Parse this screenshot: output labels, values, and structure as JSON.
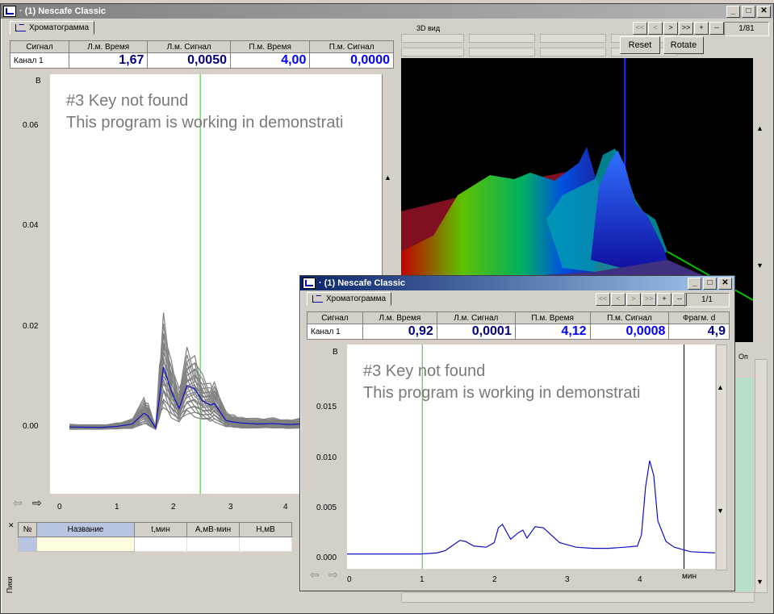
{
  "back_window": {
    "title": "· (1) Nescafe Classic",
    "tab": "Хроматограмма",
    "headers": [
      "Сигнал",
      "Л.м. Время",
      "Л.м. Сигнал",
      "П.м. Время",
      "П.м. Сигнал"
    ],
    "row": {
      "channel": "Канал 1",
      "l_time": "1,67",
      "l_signal": "0,0050",
      "r_time": "4,00",
      "r_signal": "0,0000"
    },
    "demo_line1": "#3 Key not found",
    "demo_line2": "This program is working in demonstrati",
    "y_unit": "В",
    "y_ticks": [
      "0.06",
      "0.04",
      "0.02",
      "0.00"
    ],
    "x_ticks": [
      "0",
      "1",
      "2",
      "3",
      "4"
    ],
    "view3d_label": "3D вид",
    "nav_buttons": [
      "<<",
      "<",
      ">",
      ">>",
      "+",
      "--"
    ],
    "counter": "1/81",
    "reset_label": "Reset",
    "rotate_label": "Rotate",
    "peaks_headers": [
      "№",
      "Название",
      "t,мин",
      "A,мВ·мин",
      "H,мВ"
    ],
    "peaks_side_label": "Пики",
    "right_col_label": "Оп"
  },
  "front_window": {
    "title": "· (1) Nescafe Classic",
    "tab": "Хроматограмма",
    "nav_buttons": [
      "<<",
      "<",
      ">",
      ">>",
      "+",
      "--"
    ],
    "counter": "1/1",
    "headers": [
      "Сигнал",
      "Л.м. Время",
      "Л.м. Сигнал",
      "П.м. Время",
      "П.м. Сигнал",
      "Фрагм. d"
    ],
    "row": {
      "channel": "Канал 1",
      "l_time": "0,92",
      "l_signal": "0,0001",
      "r_time": "4,12",
      "r_signal": "0,0008",
      "frag": "4,9"
    },
    "demo_line1": "#3 Key not found",
    "demo_line2": "This program is working in demonstrati",
    "y_unit": "В",
    "y_ticks": [
      "0.015",
      "0.010",
      "0.005",
      "0.000"
    ],
    "x_ticks": [
      "0",
      "1",
      "2",
      "3",
      "4"
    ],
    "x_unit": "мин"
  },
  "chart_data": [
    {
      "type": "line",
      "ylim": [
        -0.013,
        0.073
      ],
      "xlim": [
        -0.25,
        4.0
      ],
      "cursors": [
        1.67,
        4.0
      ],
      "series": [
        {
          "x": [
            0,
            0.4,
            0.6,
            0.8,
            0.95,
            1.0,
            1.1,
            1.15,
            1.2,
            1.3,
            1.4,
            1.5,
            1.6,
            1.7,
            1.8,
            1.85,
            2.0,
            2.1,
            2.2,
            2.4,
            2.6,
            2.8,
            2.95,
            3.05,
            3.1,
            3.15,
            3.2,
            3.25,
            3.35,
            3.6,
            4.0
          ],
          "y": [
            0.0007,
            0.0006,
            0.0008,
            0.0013,
            0.0035,
            0.003,
            0.0005,
            0.007,
            0.013,
            0.008,
            0.0045,
            0.0092,
            0.0085,
            0.006,
            0.0052,
            0.0055,
            0.002,
            0.0017,
            0.0015,
            0.0013,
            0.0014,
            0.0012,
            0.0013,
            0.0022,
            0.007,
            0.0098,
            0.0082,
            0.0025,
            0.0002,
            0.0,
            0.0
          ]
        }
      ]
    },
    {
      "type": "line",
      "ylim": [
        -0.0012,
        0.0185
      ],
      "xlim": [
        0,
        4.5
      ],
      "cursors": [
        0.92,
        4.12
      ],
      "series": [
        {
          "x": [
            0,
            0.3,
            0.6,
            0.9,
            1.1,
            1.2,
            1.3,
            1.38,
            1.45,
            1.55,
            1.7,
            1.8,
            1.85,
            1.9,
            2.0,
            2.1,
            2.15,
            2.2,
            2.3,
            2.4,
            2.6,
            2.8,
            3.0,
            3.2,
            3.4,
            3.55,
            3.6,
            3.65,
            3.7,
            3.75,
            3.8,
            3.9,
            4.0,
            4.2,
            4.5
          ],
          "y": [
            0.0001,
            0.0001,
            0.0001,
            0.0001,
            0.0002,
            0.0004,
            0.0009,
            0.0013,
            0.0012,
            0.0008,
            0.0007,
            0.0011,
            0.0024,
            0.0027,
            0.0014,
            0.002,
            0.0022,
            0.0015,
            0.0025,
            0.0024,
            0.0011,
            0.0007,
            0.0006,
            0.0006,
            0.0007,
            0.0008,
            0.0018,
            0.006,
            0.0083,
            0.007,
            0.003,
            0.0012,
            0.0007,
            0.0003,
            0.0002
          ]
        }
      ]
    }
  ]
}
